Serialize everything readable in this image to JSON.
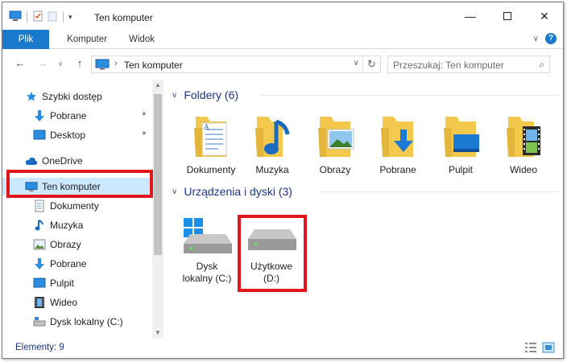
{
  "window": {
    "title": "Ten komputer"
  },
  "ribbon": {
    "tabs": [
      {
        "label": "Plik"
      },
      {
        "label": "Komputer"
      },
      {
        "label": "Widok"
      }
    ]
  },
  "address": {
    "path": "Ten komputer"
  },
  "search": {
    "placeholder": "Przeszukaj: Ten komputer"
  },
  "nav": {
    "items": [
      {
        "label": "Szybki dostęp",
        "icon": "star-icon"
      },
      {
        "label": "Pobrane",
        "icon": "download-icon",
        "pinned": true
      },
      {
        "label": "Desktop",
        "icon": "desktop-icon",
        "pinned": true
      },
      {
        "label": "OneDrive",
        "icon": "cloud-icon"
      },
      {
        "label": "Ten komputer",
        "icon": "computer-icon",
        "selected": true
      },
      {
        "label": "Dokumenty",
        "icon": "documents-icon"
      },
      {
        "label": "Muzyka",
        "icon": "music-icon"
      },
      {
        "label": "Obrazy",
        "icon": "pictures-icon"
      },
      {
        "label": "Pobrane",
        "icon": "download-icon"
      },
      {
        "label": "Pulpit",
        "icon": "desktop-icon"
      },
      {
        "label": "Wideo",
        "icon": "video-icon"
      },
      {
        "label": "Dysk lokalny (C:)",
        "icon": "drive-icon"
      }
    ]
  },
  "content": {
    "folders_header": "Foldery (6)",
    "folders": [
      {
        "label": "Dokumenty",
        "icon": "documents-folder-icon"
      },
      {
        "label": "Muzyka",
        "icon": "music-folder-icon"
      },
      {
        "label": "Obrazy",
        "icon": "pictures-folder-icon"
      },
      {
        "label": "Pobrane",
        "icon": "downloads-folder-icon"
      },
      {
        "label": "Pulpit",
        "icon": "desktop-folder-icon"
      },
      {
        "label": "Wideo",
        "icon": "video-folder-icon"
      }
    ],
    "drives_header": "Urządzenia i dyski (3)",
    "drives": [
      {
        "line1": "Dysk",
        "line2": "lokalny (C:)",
        "icon": "system-drive-icon"
      },
      {
        "line1": "Użytkowe",
        "line2": "(D:)",
        "icon": "hard-drive-icon"
      }
    ]
  },
  "status": {
    "text": "Elementy: 9"
  },
  "colors": {
    "accent": "#1979ca",
    "highlight": "#e1151c",
    "folder": "#f2c94c",
    "link": "#1e3287"
  }
}
